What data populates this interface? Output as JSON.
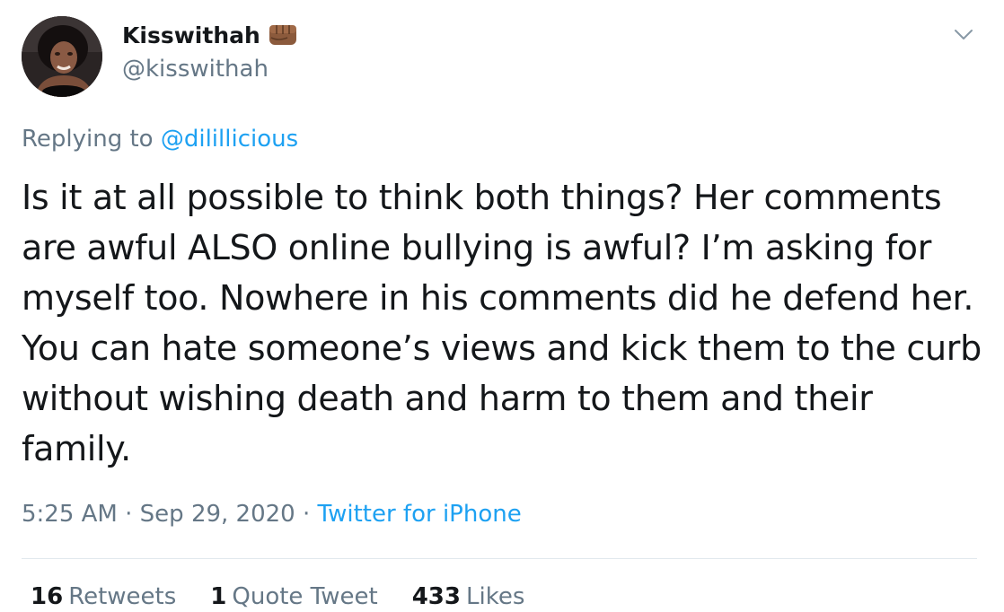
{
  "user": {
    "display_name": "Kisswithah",
    "handle": "@kisswithah",
    "badge_icon": "fist-emoji-icon"
  },
  "reply": {
    "prefix": "Replying to",
    "mention": "@dilillicious"
  },
  "tweet": {
    "text": "Is it at all possible to think both things? Her comments are awful ALSO online bullying is awful? I’m asking for myself too. Nowhere in his comments did he defend her. You can hate someone’s views and kick them to the curb without wishing death and harm to them and their family."
  },
  "meta": {
    "time": "5:25 AM",
    "separator": "·",
    "date": "Sep 29, 2020",
    "source": "Twitter for iPhone"
  },
  "stats": {
    "retweets_count": "16",
    "retweets_label": "Retweets",
    "quotes_count": "1",
    "quotes_label": "Quote Tweet",
    "likes_count": "433",
    "likes_label": "Likes"
  },
  "colors": {
    "link": "#1da1f2",
    "secondary": "#657786",
    "primary": "#14171a",
    "divider": "#e1e8ed"
  }
}
